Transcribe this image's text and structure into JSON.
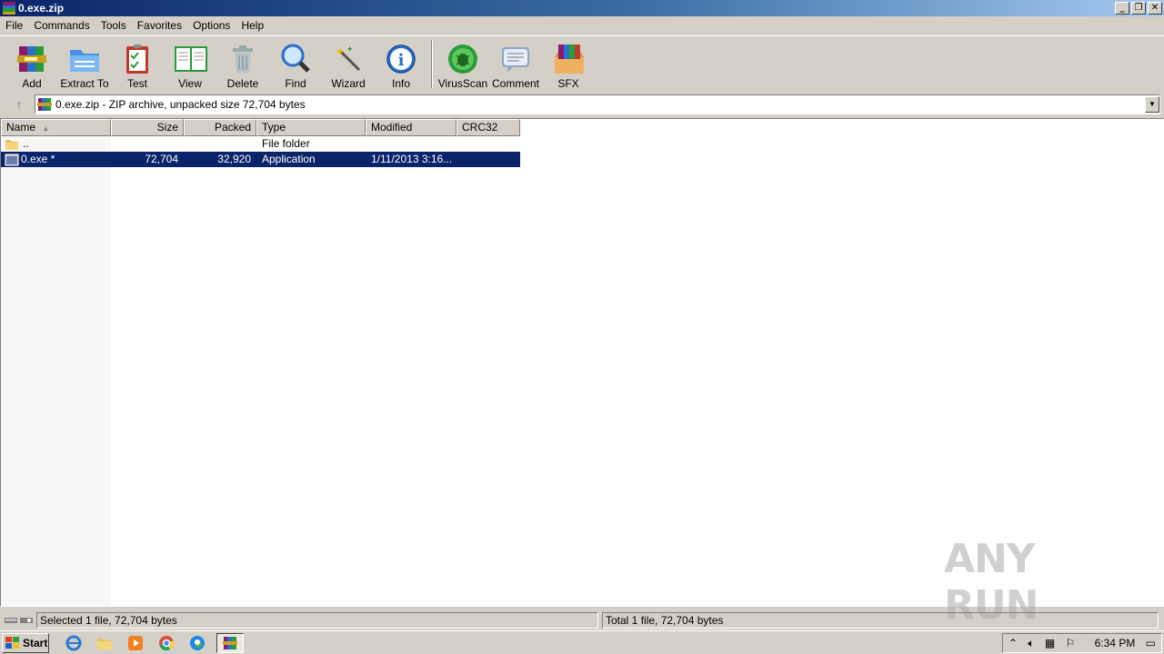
{
  "window": {
    "title": "0.exe.zip"
  },
  "menu": [
    "File",
    "Commands",
    "Tools",
    "Favorites",
    "Options",
    "Help"
  ],
  "toolbar": [
    {
      "label": "Add",
      "icon": "add-archive-icon"
    },
    {
      "label": "Extract To",
      "icon": "extract-folder-icon"
    },
    {
      "label": "Test",
      "icon": "test-clipboard-icon"
    },
    {
      "label": "View",
      "icon": "view-book-icon"
    },
    {
      "label": "Delete",
      "icon": "trash-icon"
    },
    {
      "label": "Find",
      "icon": "magnifier-icon"
    },
    {
      "label": "Wizard",
      "icon": "wand-icon"
    },
    {
      "label": "Info",
      "icon": "info-icon"
    },
    {
      "label": "VirusScan",
      "icon": "bug-icon"
    },
    {
      "label": "Comment",
      "icon": "comment-icon"
    },
    {
      "label": "SFX",
      "icon": "sfx-box-icon"
    }
  ],
  "address": {
    "text": "0.exe.zip - ZIP archive, unpacked size 72,704 bytes"
  },
  "columns": [
    "Name",
    "Size",
    "Packed",
    "Type",
    "Modified",
    "CRC32"
  ],
  "rows": [
    {
      "name": "..",
      "size": "",
      "packed": "",
      "type": "File folder",
      "modified": "",
      "crc": "",
      "selected": false,
      "icon": "folder-icon"
    },
    {
      "name": "0.exe *",
      "size": "72,704",
      "packed": "32,920",
      "type": "Application",
      "modified": "1/11/2013 3:16...",
      "crc": "",
      "selected": true,
      "icon": "exe-file-icon"
    }
  ],
  "status": {
    "left": "Selected 1 file, 72,704 bytes",
    "right": "Total 1 file, 72,704 bytes"
  },
  "taskbar": {
    "start": "Start",
    "clock": "6:34 PM"
  },
  "watermark": "ANY RUN",
  "colors": {
    "selection": "#0a246a",
    "titlebar": "#0a246a"
  }
}
